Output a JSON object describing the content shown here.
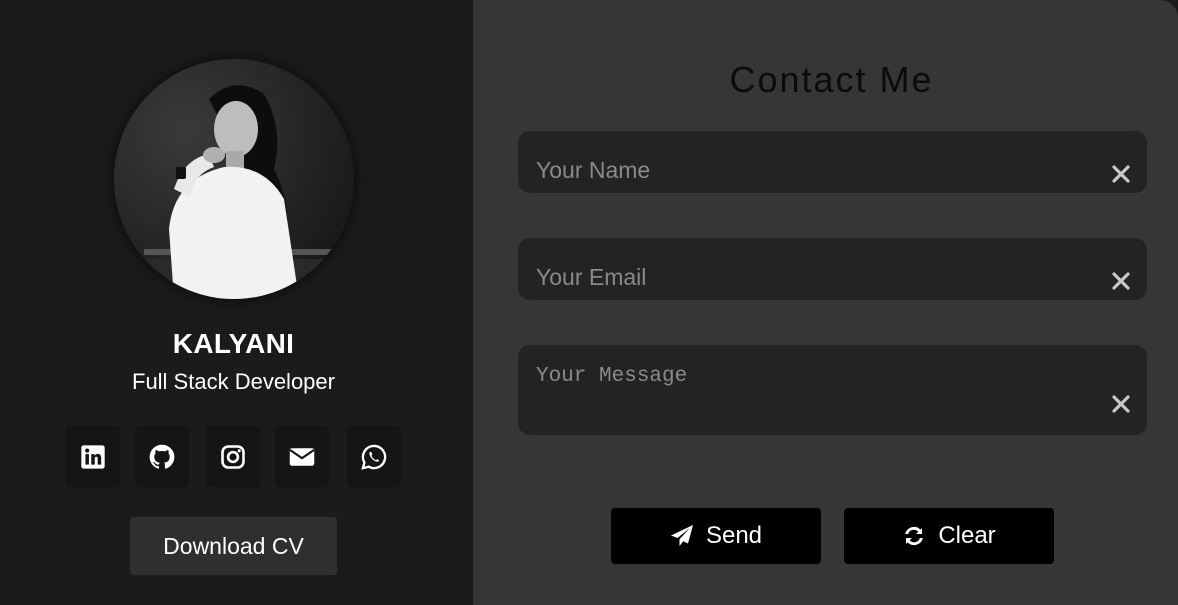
{
  "profile": {
    "name": "KALYANI",
    "role": "Full Stack Developer",
    "avatar_alt": "profile-photo"
  },
  "social": [
    {
      "id": "linkedin",
      "icon": "linkedin-icon"
    },
    {
      "id": "github",
      "icon": "github-icon"
    },
    {
      "id": "instagram",
      "icon": "instagram-icon"
    },
    {
      "id": "email",
      "icon": "envelope-icon"
    },
    {
      "id": "whatsapp",
      "icon": "whatsapp-icon"
    }
  ],
  "download_label": "Download CV",
  "contact": {
    "title": "Contact Me",
    "name_placeholder": "Your Name",
    "email_placeholder": "Your Email",
    "message_placeholder": "Your Message",
    "send_label": "Send",
    "clear_label": "Clear"
  },
  "colors": {
    "left_bg": "#1b1b1b",
    "right_bg": "#363636",
    "field_bg": "#232323",
    "button_bg": "#000000",
    "text": "#ffffff"
  }
}
